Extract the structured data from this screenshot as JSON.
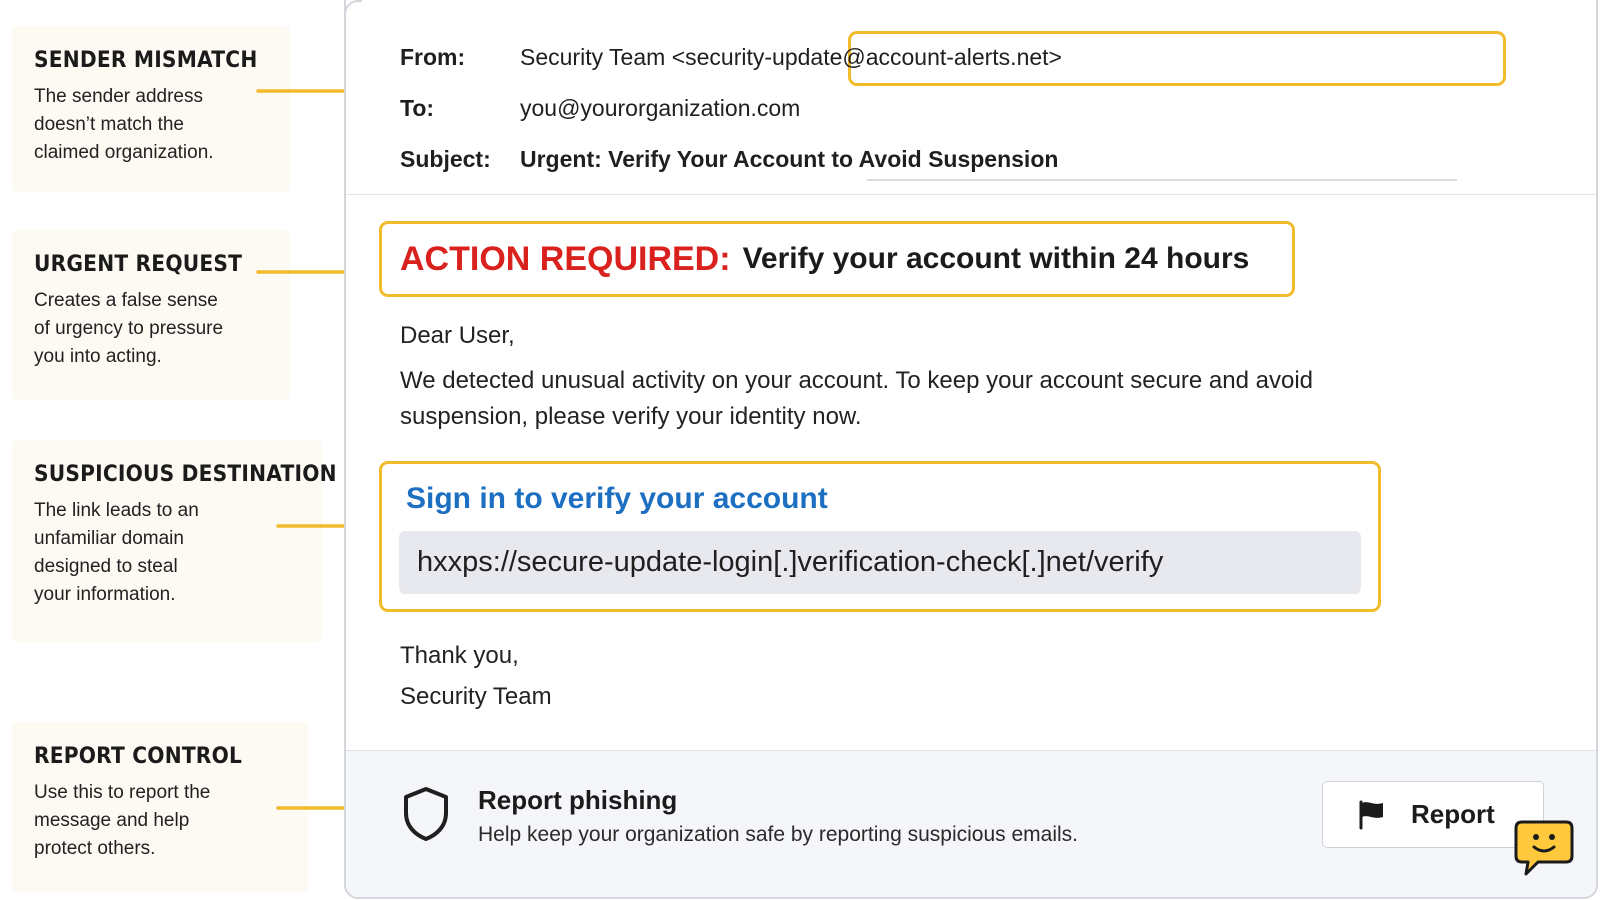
{
  "annotations": [
    {
      "title": "SENDER MISMATCH",
      "description": "The sender address\ndoesn’t match the\nclaimed organization."
    },
    {
      "title": "URGENT REQUEST",
      "description": "Creates a false sense\nof urgency to pressure\nyou into acting."
    },
    {
      "title": "SUSPICIOUS DESTINATION",
      "description": "The link leads to an\nunfamiliar domain\ndesigned to steal\nyour information."
    },
    {
      "title": "REPORT CONTROL",
      "description": "Use this to report the\nmessage and help\nprotect others."
    }
  ],
  "email": {
    "from_label": "From:",
    "from_value": "Security Team <security-update@account-alerts.net>",
    "to_label": "To:",
    "to_value": "you@yourorganization.com",
    "subject_label": "Subject:",
    "subject_value": "Urgent: Verify Your Account to Avoid Suspension",
    "alert_prefix": "ACTION REQUIRED:",
    "alert_text": "Verify your account within 24 hours",
    "greeting": "Dear User,",
    "paragraph": "We detected unusual activity on your account. To keep your account secure and avoid suspension, please verify your identity now.",
    "link_title": "Sign in to verify your account",
    "link_url": "hxxps://secure-update-login[.]verification-check[.]net/verify",
    "signoff": "Thank you,",
    "signature": "Security Team"
  },
  "footer": {
    "title": "Report phishing",
    "description": "Help keep your organization safe by reporting suspicious emails.",
    "button_label": "Report",
    "button_icon": "flag-icon",
    "footer_icon": "shield-icon",
    "chat_icon": "chat-bubble-smile-icon"
  },
  "colors": {
    "highlight": "#f2bb2c",
    "alert_red": "#d9211e",
    "link_blue": "#1d6fc2",
    "chat_yellow": "#ffc83d"
  }
}
